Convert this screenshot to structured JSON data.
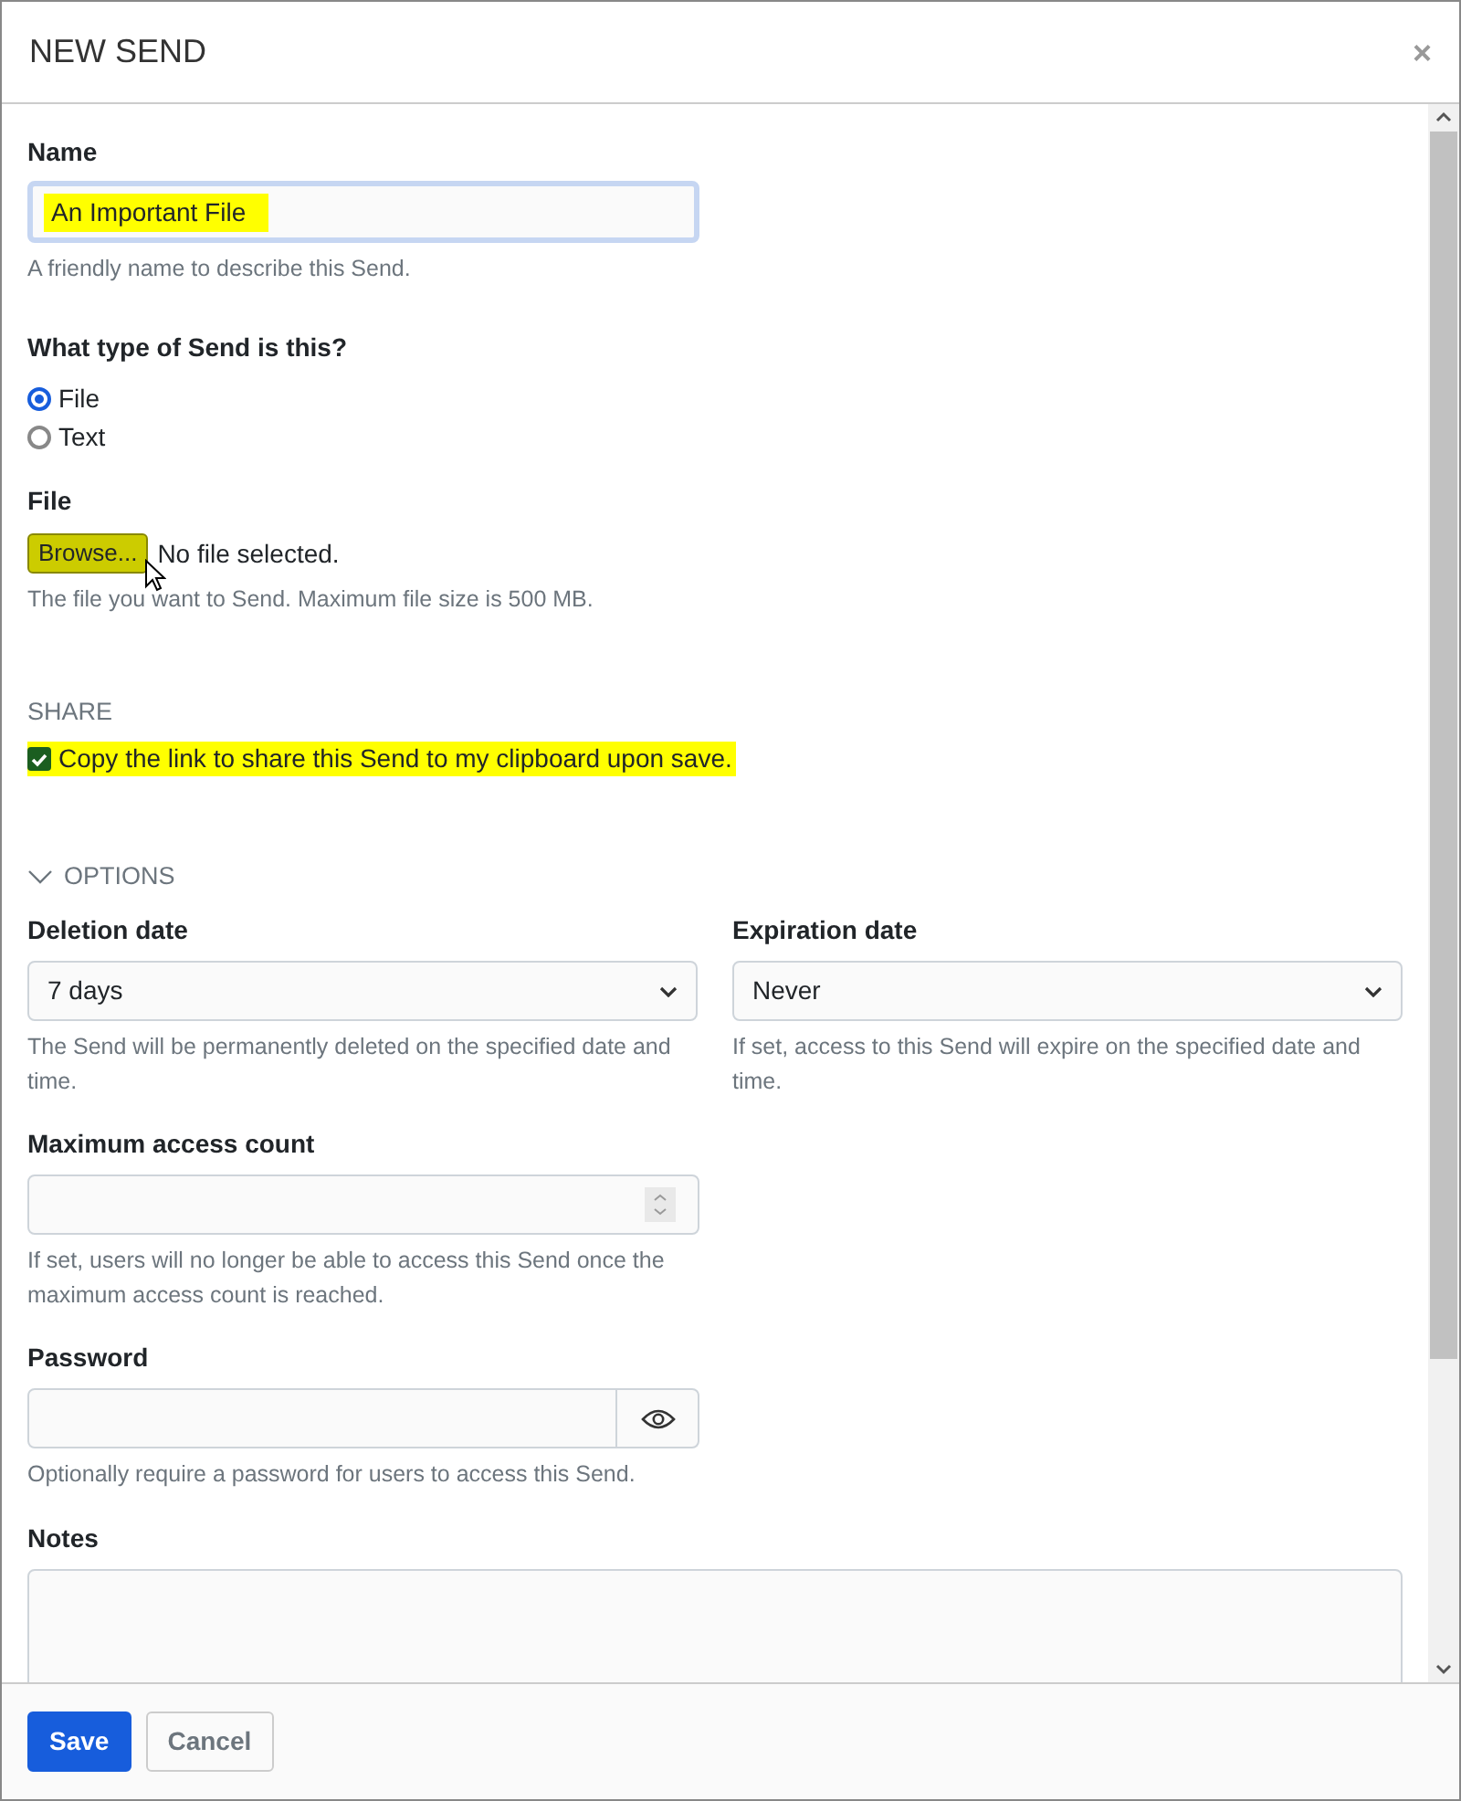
{
  "dialog": {
    "title": "NEW SEND",
    "close": "×"
  },
  "name_field": {
    "label": "Name",
    "value": "An Important File",
    "highlighted": true,
    "help": "A friendly name to describe this Send."
  },
  "send_type": {
    "label": "What type of Send is this?",
    "options": [
      {
        "label": "File",
        "selected": true
      },
      {
        "label": "Text",
        "selected": false
      }
    ]
  },
  "file_field": {
    "label": "File",
    "button": "Browse...",
    "button_highlighted": true,
    "status": "No file selected.",
    "help": "The file you want to Send. Maximum file size is 500 MB."
  },
  "share": {
    "heading": "SHARE",
    "checkbox": {
      "label": "Copy the link to share this Send to my clipboard upon save.",
      "checked": true,
      "highlighted": true
    }
  },
  "options": {
    "label": "OPTIONS",
    "expanded": true
  },
  "deletion_date": {
    "label": "Deletion date",
    "value": "7 days",
    "help": "The Send will be permanently deleted on the specified date and time."
  },
  "expiration_date": {
    "label": "Expiration date",
    "value": "Never",
    "help": "If set, access to this Send will expire on the specified date and time."
  },
  "max_access": {
    "label": "Maximum access count",
    "help": "If set, users will no longer be able to access this Send once the maximum access count is reached."
  },
  "password": {
    "label": "Password",
    "help": "Optionally require a password for users to access this Send."
  },
  "notes": {
    "label": "Notes"
  },
  "footer": {
    "buttons": [
      {
        "label": "Save",
        "kind": "primary"
      },
      {
        "label": "Cancel",
        "kind": "secondary"
      }
    ]
  }
}
